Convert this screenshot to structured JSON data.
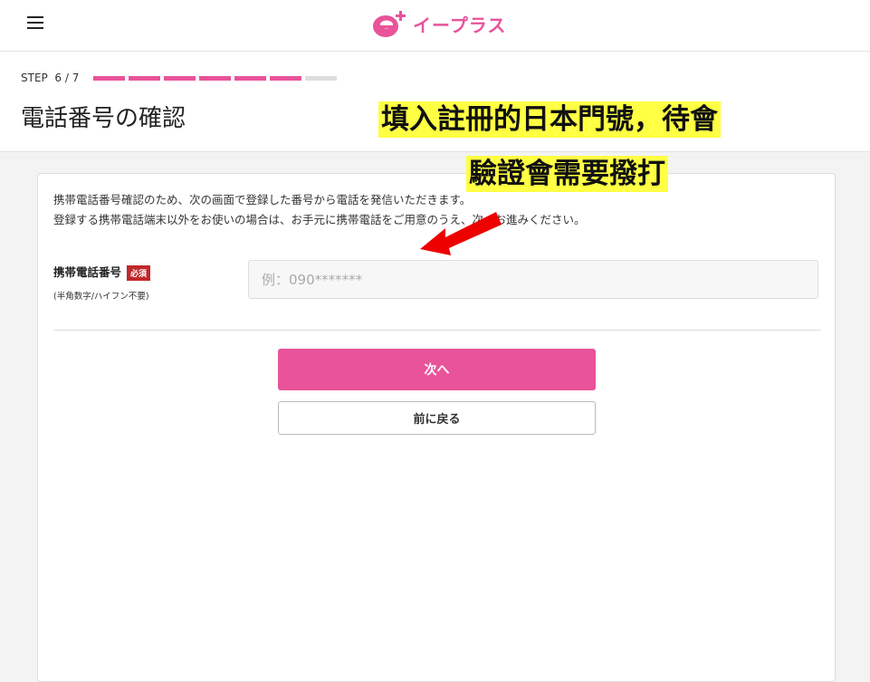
{
  "header": {
    "logo_text": "イープラス",
    "brand_color": "#e8539a"
  },
  "steps": {
    "label": "STEP",
    "current": 6,
    "total": 7,
    "counter": "6 / 7"
  },
  "page": {
    "title": "電話番号の確認"
  },
  "annotations": {
    "line1": "填入註冊的日本門號，待會",
    "line2": "驗證會需要撥打"
  },
  "form": {
    "notice_line1": "携帯電話番号確認のため、次の画面で登録した番号から電話を発信いただきます。",
    "notice_line2": "登録する携帯電話端末以外をお使いの場合は、お手元に携帯電話をご用意のうえ、次へお進みください。",
    "phone_label": "携帯電話番号",
    "required_badge": "必須",
    "phone_hint": "(半角数字/ハイフン不要)",
    "phone_placeholder": "例：090*******",
    "phone_value": ""
  },
  "buttons": {
    "next": "次へ",
    "back": "前に戻る"
  },
  "icons": {
    "menu": "hamburger-menu-icon",
    "logo": "eplus-logo-icon",
    "arrow": "red-arrow-icon"
  }
}
